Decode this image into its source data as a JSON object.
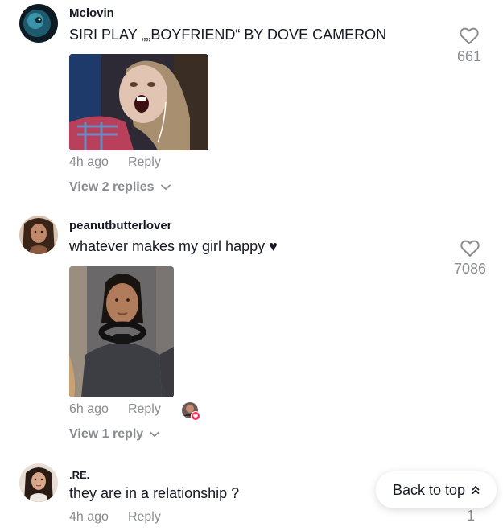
{
  "comments": [
    {
      "username": "Mclovin",
      "text": "SIRI PLAY „„BOYFRIEND“ BY DOVE CAMERON",
      "time": "4h ago",
      "reply_label": "Reply",
      "view_replies": "View 2 replies",
      "likes": "661",
      "avatar_icon": "blue-creature-avatar",
      "media_icon": "screaming-woman-photo"
    },
    {
      "username": "peanutbutterlover",
      "text": "whatever makes my girl happy",
      "text_suffix": "♥",
      "time": "6h ago",
      "reply_label": "Reply",
      "view_replies": "View 1 reply",
      "likes": "7086",
      "avatar_icon": "woman-portrait-avatar",
      "media_icon": "woman-headphones-photo"
    },
    {
      "username": ".RE.",
      "text": "they are in a relationship ?",
      "time": "4h ago",
      "reply_label": "Reply",
      "likes": "1",
      "avatar_icon": "woman-portrait-avatar"
    }
  ],
  "back_to_top": "Back to top",
  "colors": {
    "text": "#161823",
    "muted": "#8a8b91",
    "creator_heart": "#fe2c55"
  }
}
